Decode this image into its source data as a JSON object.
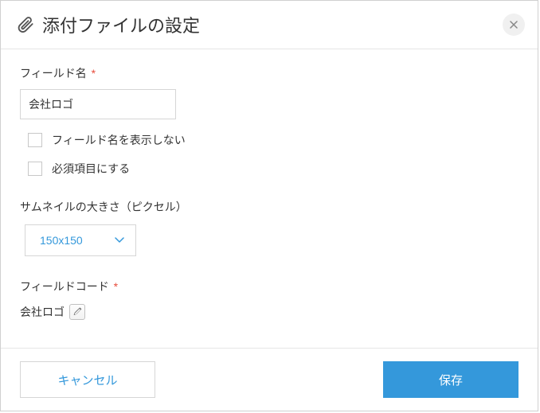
{
  "dialog": {
    "title": "添付ファイルの設定"
  },
  "field_name": {
    "label": "フィールド名",
    "required_mark": "*",
    "value": "会社ロゴ"
  },
  "checkboxes": {
    "hide_field_name": {
      "label": "フィールド名を表示しない",
      "checked": false
    },
    "required_field": {
      "label": "必須項目にする",
      "checked": false
    }
  },
  "thumbnail": {
    "label": "サムネイルの大きさ（ピクセル）",
    "selected": "150x150"
  },
  "field_code": {
    "label": "フィールドコード",
    "required_mark": "*",
    "value": "会社ロゴ"
  },
  "footer": {
    "cancel": "キャンセル",
    "save": "保存"
  }
}
